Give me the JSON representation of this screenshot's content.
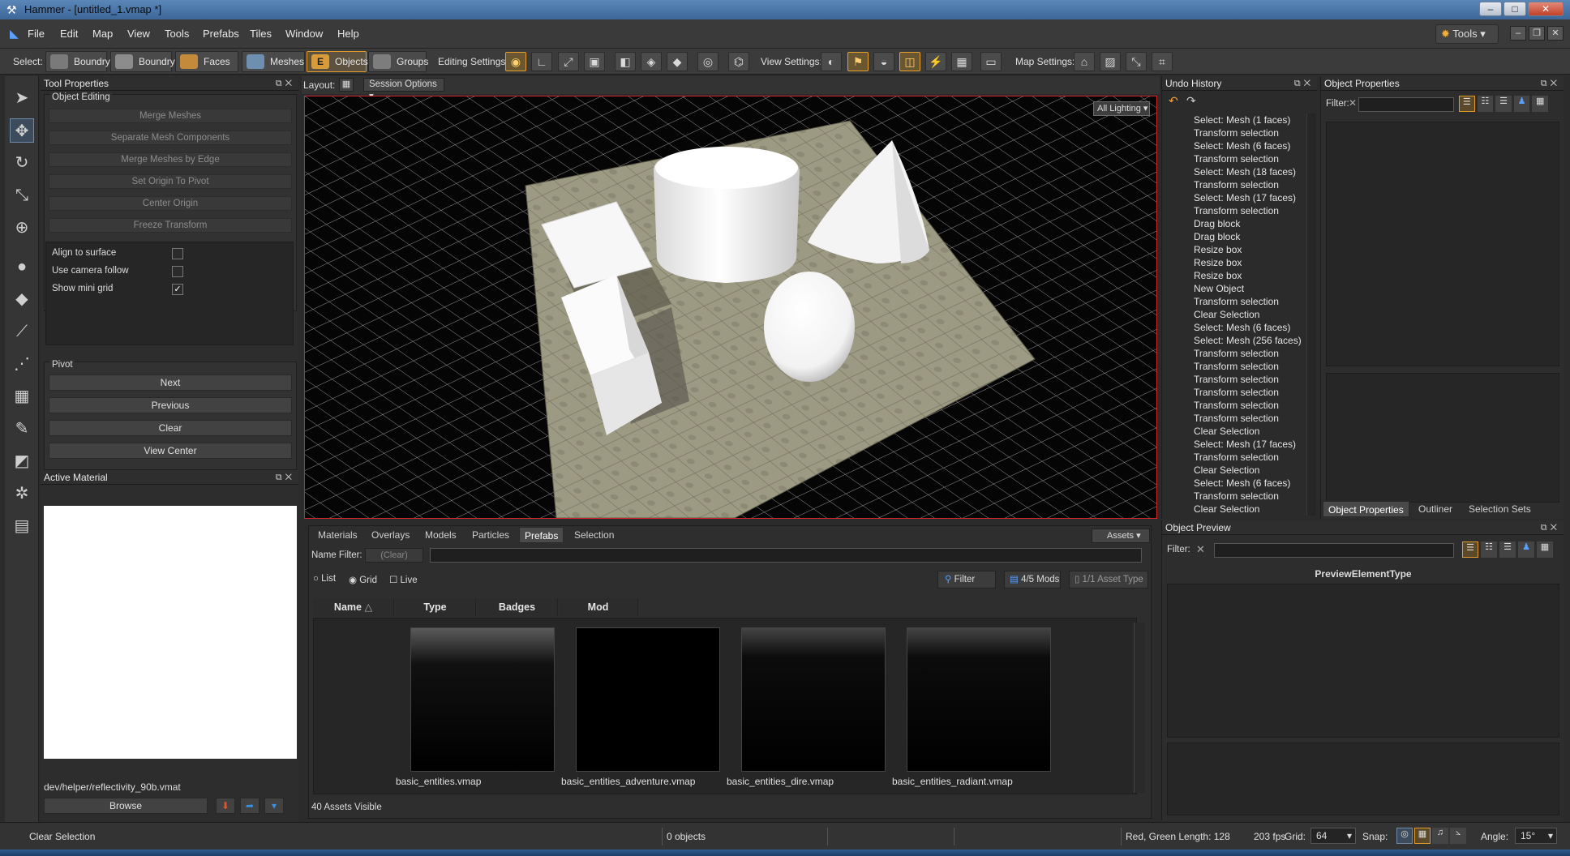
{
  "window": {
    "title": "Hammer - [untitled_1.vmap *]"
  },
  "menu": [
    "File",
    "Edit",
    "Map",
    "View",
    "Tools",
    "Prefabs",
    "Tiles",
    "Window",
    "Help"
  ],
  "tools_menu": "Tools",
  "toolbar": {
    "select_label": "Select:",
    "select_buttons": [
      "Boundry",
      "Boundry",
      "Faces",
      "Meshes",
      "Objects",
      "Groups"
    ],
    "editing_label": "Editing Settings:",
    "view_label": "View Settings:",
    "map_label": "Map Settings:"
  },
  "tool_properties": {
    "title": "Tool Properties",
    "section": "Object Editing",
    "buttons": [
      "Merge Meshes",
      "Separate Mesh Components",
      "Merge Meshes by Edge",
      "Set Origin To Pivot",
      "Center Origin",
      "Freeze Transform"
    ],
    "options": [
      {
        "label": "Align to surface",
        "checked": false
      },
      {
        "label": "Use camera follow",
        "checked": false
      },
      {
        "label": "Show mini grid",
        "checked": true
      }
    ],
    "pivot_label": "Pivot",
    "pivot_buttons": [
      "Next",
      "Previous",
      "Clear",
      "View Center"
    ]
  },
  "active_material": {
    "title": "Active Material",
    "path": "dev/helper/reflectivity_90b.vmat",
    "browse": "Browse"
  },
  "viewport": {
    "layout_label": "Layout:",
    "session_options": "Session Options",
    "lighting": "All Lighting"
  },
  "asset_browser": {
    "tabs": [
      "Materials",
      "Overlays",
      "Models",
      "Particles",
      "Prefabs",
      "Selection"
    ],
    "active_tab": "Prefabs",
    "assets_dropdown": "Assets",
    "name_filter_label": "Name Filter:",
    "clear_label": "(Clear)",
    "view_modes": [
      "List",
      "Grid",
      "Live"
    ],
    "filter_btn": "Filter",
    "mods_btn": "4/5 Mods",
    "asset_type_btn": "1/1 Asset Type",
    "columns": [
      "Name",
      "Type",
      "Badges",
      "Mod"
    ],
    "assets": [
      "basic_entities.vmap",
      "basic_entities_adventure.vmap",
      "basic_entities_dire.vmap",
      "basic_entities_radiant.vmap"
    ],
    "visible_count": "40 Assets Visible"
  },
  "undo_history": {
    "title": "Undo History",
    "items": [
      "Select: Mesh (1 faces)",
      "Transform selection",
      "Select: Mesh (6 faces)",
      "Transform selection",
      "Select: Mesh (18 faces)",
      "Transform selection",
      "Select: Mesh (17 faces)",
      "Transform selection",
      "Drag block",
      "Drag block",
      "Resize box",
      "Resize box",
      "Resize box",
      "New Object",
      "Transform selection",
      "Clear Selection",
      "Select: Mesh (6 faces)",
      "Select: Mesh (256 faces)",
      "Transform selection",
      "Transform selection",
      "Transform selection",
      "Transform selection",
      "Transform selection",
      "Transform selection",
      "Clear Selection",
      "Select: Mesh (17 faces)",
      "Transform selection",
      "Clear Selection",
      "Select: Mesh (6 faces)",
      "Transform selection",
      "Clear Selection"
    ]
  },
  "object_properties": {
    "title": "Object Properties",
    "filter_label": "Filter:",
    "tabs": [
      "Object Properties",
      "Outliner",
      "Selection Sets"
    ]
  },
  "object_preview": {
    "title": "Object Preview",
    "filter_label": "Filter:",
    "element": "PreviewElementType"
  },
  "status": {
    "message": "Clear Selection",
    "objects": "0 objects",
    "length": "Red, Green Length: 128",
    "fps": "203 fps",
    "grid_label": "Grid:",
    "grid_value": "64",
    "snap_label": "Snap:",
    "angle_label": "Angle:",
    "angle_value": "15°"
  }
}
